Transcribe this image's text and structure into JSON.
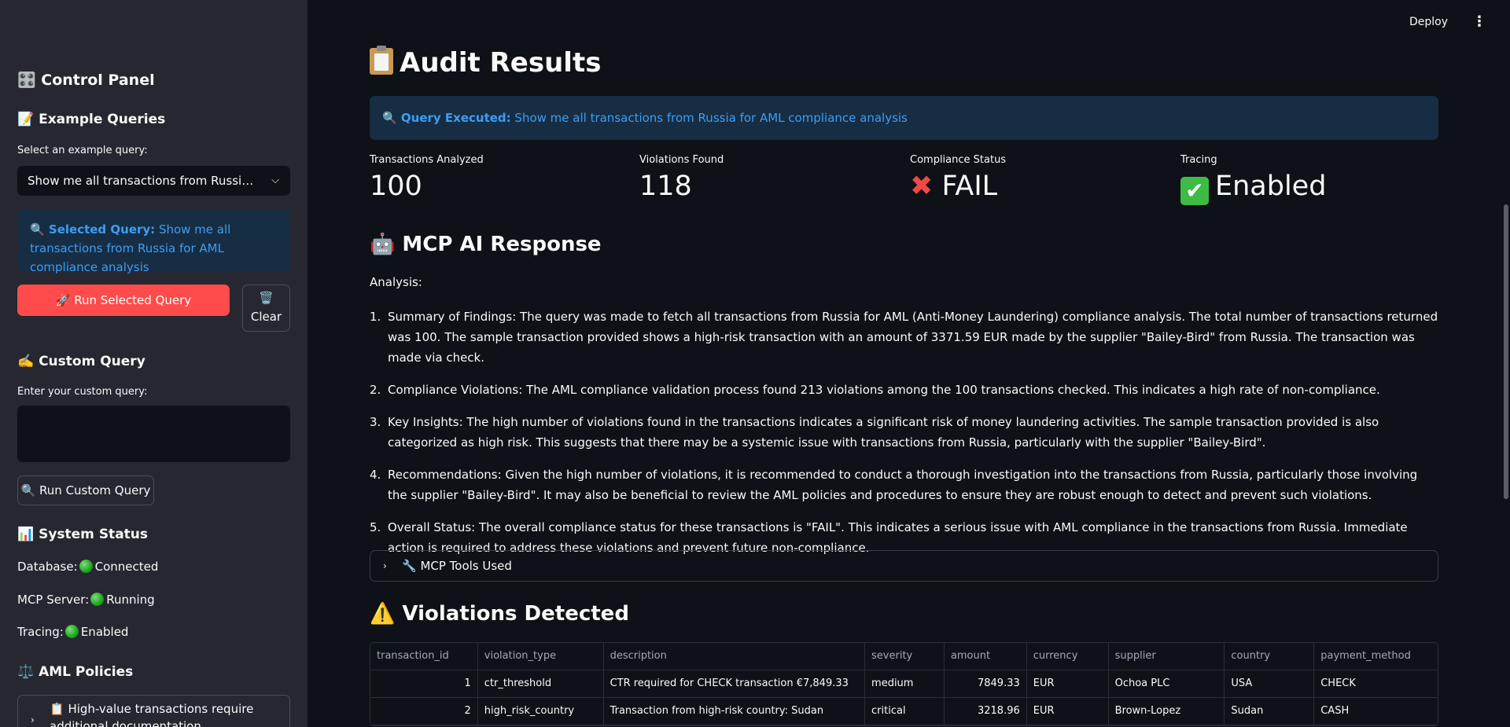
{
  "topbar": {
    "deploy_label": "Deploy",
    "menu_icon": "more-vertical-icon"
  },
  "sidebar": {
    "control_panel_title": "🎛️ Control Panel",
    "example_queries_title": "📝 Example Queries",
    "select_label": "Select an example query:",
    "selected_value": "Show me all transactions from Russia for AML compliance analysis",
    "selected_query_prefix": "🔍 Selected Query:",
    "selected_query_text": " Show me all transactions from Russia for AML compliance analysis",
    "run_selected_label": "🚀 Run Selected Query",
    "clear_icon": "🗑️",
    "clear_label": "Clear",
    "custom_query_title": "✍️ Custom Query",
    "custom_query_label": "Enter your custom query:",
    "custom_query_value": "",
    "run_custom_label": "🔍 Run Custom Query",
    "system_status_title": "📊 System Status",
    "status": {
      "database_label": "Database:",
      "database_value": "Connected",
      "mcp_label": "MCP Server:",
      "mcp_value": "Running",
      "tracing_label": "Tracing:",
      "tracing_value": "Enabled"
    },
    "aml_policies_title": "⚖️ AML Policies",
    "policy_expander_label": "📋 High-value transactions require additional documentation"
  },
  "main": {
    "title": "Audit Results",
    "query_executed_prefix": "🔍 Query Executed:",
    "query_executed_text": " Show me all transactions from Russia for AML compliance analysis",
    "metrics": [
      {
        "label": "Transactions Analyzed",
        "value": "100"
      },
      {
        "label": "Violations Found",
        "value": "118"
      },
      {
        "label": "Compliance Status",
        "value": "FAIL"
      },
      {
        "label": "Tracing",
        "value": "Enabled"
      }
    ],
    "ai_response_title": "🤖 MCP AI Response",
    "analysis_label": "Analysis:",
    "findings": [
      {
        "num": "1.",
        "text": "Summary of Findings: The query was made to fetch all transactions from Russia for AML (Anti-Money Laundering) compliance analysis. The total number of transactions returned was 100. The sample transaction provided shows a high-risk transaction with an amount of 3371.59 EUR made by the supplier \"Bailey-Bird\" from Russia. The transaction was made via check."
      },
      {
        "num": "2.",
        "text": "Compliance Violations: The AML compliance validation process found 213 violations among the 100 transactions checked. This indicates a high rate of non-compliance."
      },
      {
        "num": "3.",
        "text": "Key Insights: The high number of violations found in the transactions indicates a significant risk of money laundering activities. The sample transaction provided is also categorized as high risk. This suggests that there may be a systemic issue with transactions from Russia, particularly with the supplier \"Bailey-Bird\"."
      },
      {
        "num": "4.",
        "text": "Recommendations: Given the high number of violations, it is recommended to conduct a thorough investigation into the transactions from Russia, particularly those involving the supplier \"Bailey-Bird\". It may also be beneficial to review the AML policies and procedures to ensure they are robust enough to detect and prevent such violations."
      },
      {
        "num": "5.",
        "text": "Overall Status: The overall compliance status for these transactions is \"FAIL\". This indicates a serious issue with AML compliance in the transactions from Russia. Immediate action is required to address these violations and prevent future non-compliance."
      }
    ],
    "tools_used_label": "🔧 MCP Tools Used",
    "violations_title": "⚠️ Violations Detected",
    "table": {
      "headers": [
        "transaction_id",
        "violation_type",
        "description",
        "severity",
        "amount",
        "currency",
        "supplier",
        "country",
        "payment_method"
      ],
      "rows": [
        [
          "1",
          "ctr_threshold",
          "CTR required for CHECK transaction €7,849.33",
          "medium",
          "7849.33",
          "EUR",
          "Ochoa PLC",
          "USA",
          "CHECK"
        ],
        [
          "2",
          "high_risk_country",
          "Transaction from high-risk country: Sudan",
          "critical",
          "3218.96",
          "EUR",
          "Brown-Lopez",
          "Sudan",
          "CASH"
        ]
      ]
    }
  },
  "colors": {
    "accent": "#ff4b4b",
    "info_bg": "#172d43",
    "info_text": "#3d9df3",
    "sidebar_bg": "#262730",
    "main_bg": "#0e1117"
  }
}
